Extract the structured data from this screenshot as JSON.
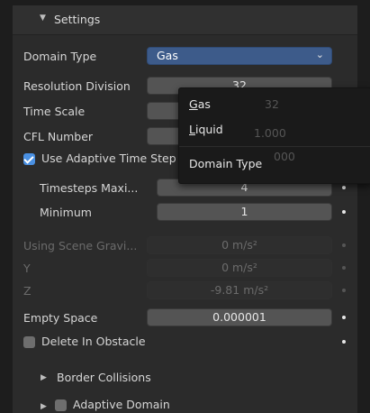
{
  "header": {
    "title": "Settings"
  },
  "rows": {
    "domain_type": {
      "label": "Domain Type",
      "value": "Gas"
    },
    "resolution": {
      "label": "Resolution Division",
      "value": "32"
    },
    "time_scale": {
      "label": "Time Scale"
    },
    "cfl": {
      "label": "CFL Number"
    },
    "adaptive_time": {
      "label": "Use Adaptive Time Step",
      "checked": true
    },
    "timesteps_max": {
      "label": "Timesteps Maxi...",
      "value": "4"
    },
    "minimum": {
      "label": "Minimum",
      "value": "1"
    },
    "gravity": {
      "label": "Using Scene Gravi...",
      "value": "0 m/s²"
    },
    "gravity_y": {
      "label": "Y",
      "value": "0 m/s²"
    },
    "gravity_z": {
      "label": "Z",
      "value": "-9.81 m/s²"
    },
    "empty_space": {
      "label": "Empty Space",
      "value": "0.000001"
    },
    "delete_obstacle": {
      "label": "Delete In Obstacle",
      "checked": false
    }
  },
  "subpanels": {
    "border_collisions": "Border Collisions",
    "adaptive_domain": "Adaptive Domain"
  },
  "dropdown": {
    "options": [
      {
        "underline": "G",
        "rest": "as"
      },
      {
        "underline": "L",
        "rest": "iquid"
      }
    ],
    "footer": "Domain Type",
    "ghost_values": [
      "32",
      "1.000",
      "000"
    ]
  },
  "colors": {
    "accent": "#3d5b8a",
    "checkbox": "#4a90e2"
  }
}
